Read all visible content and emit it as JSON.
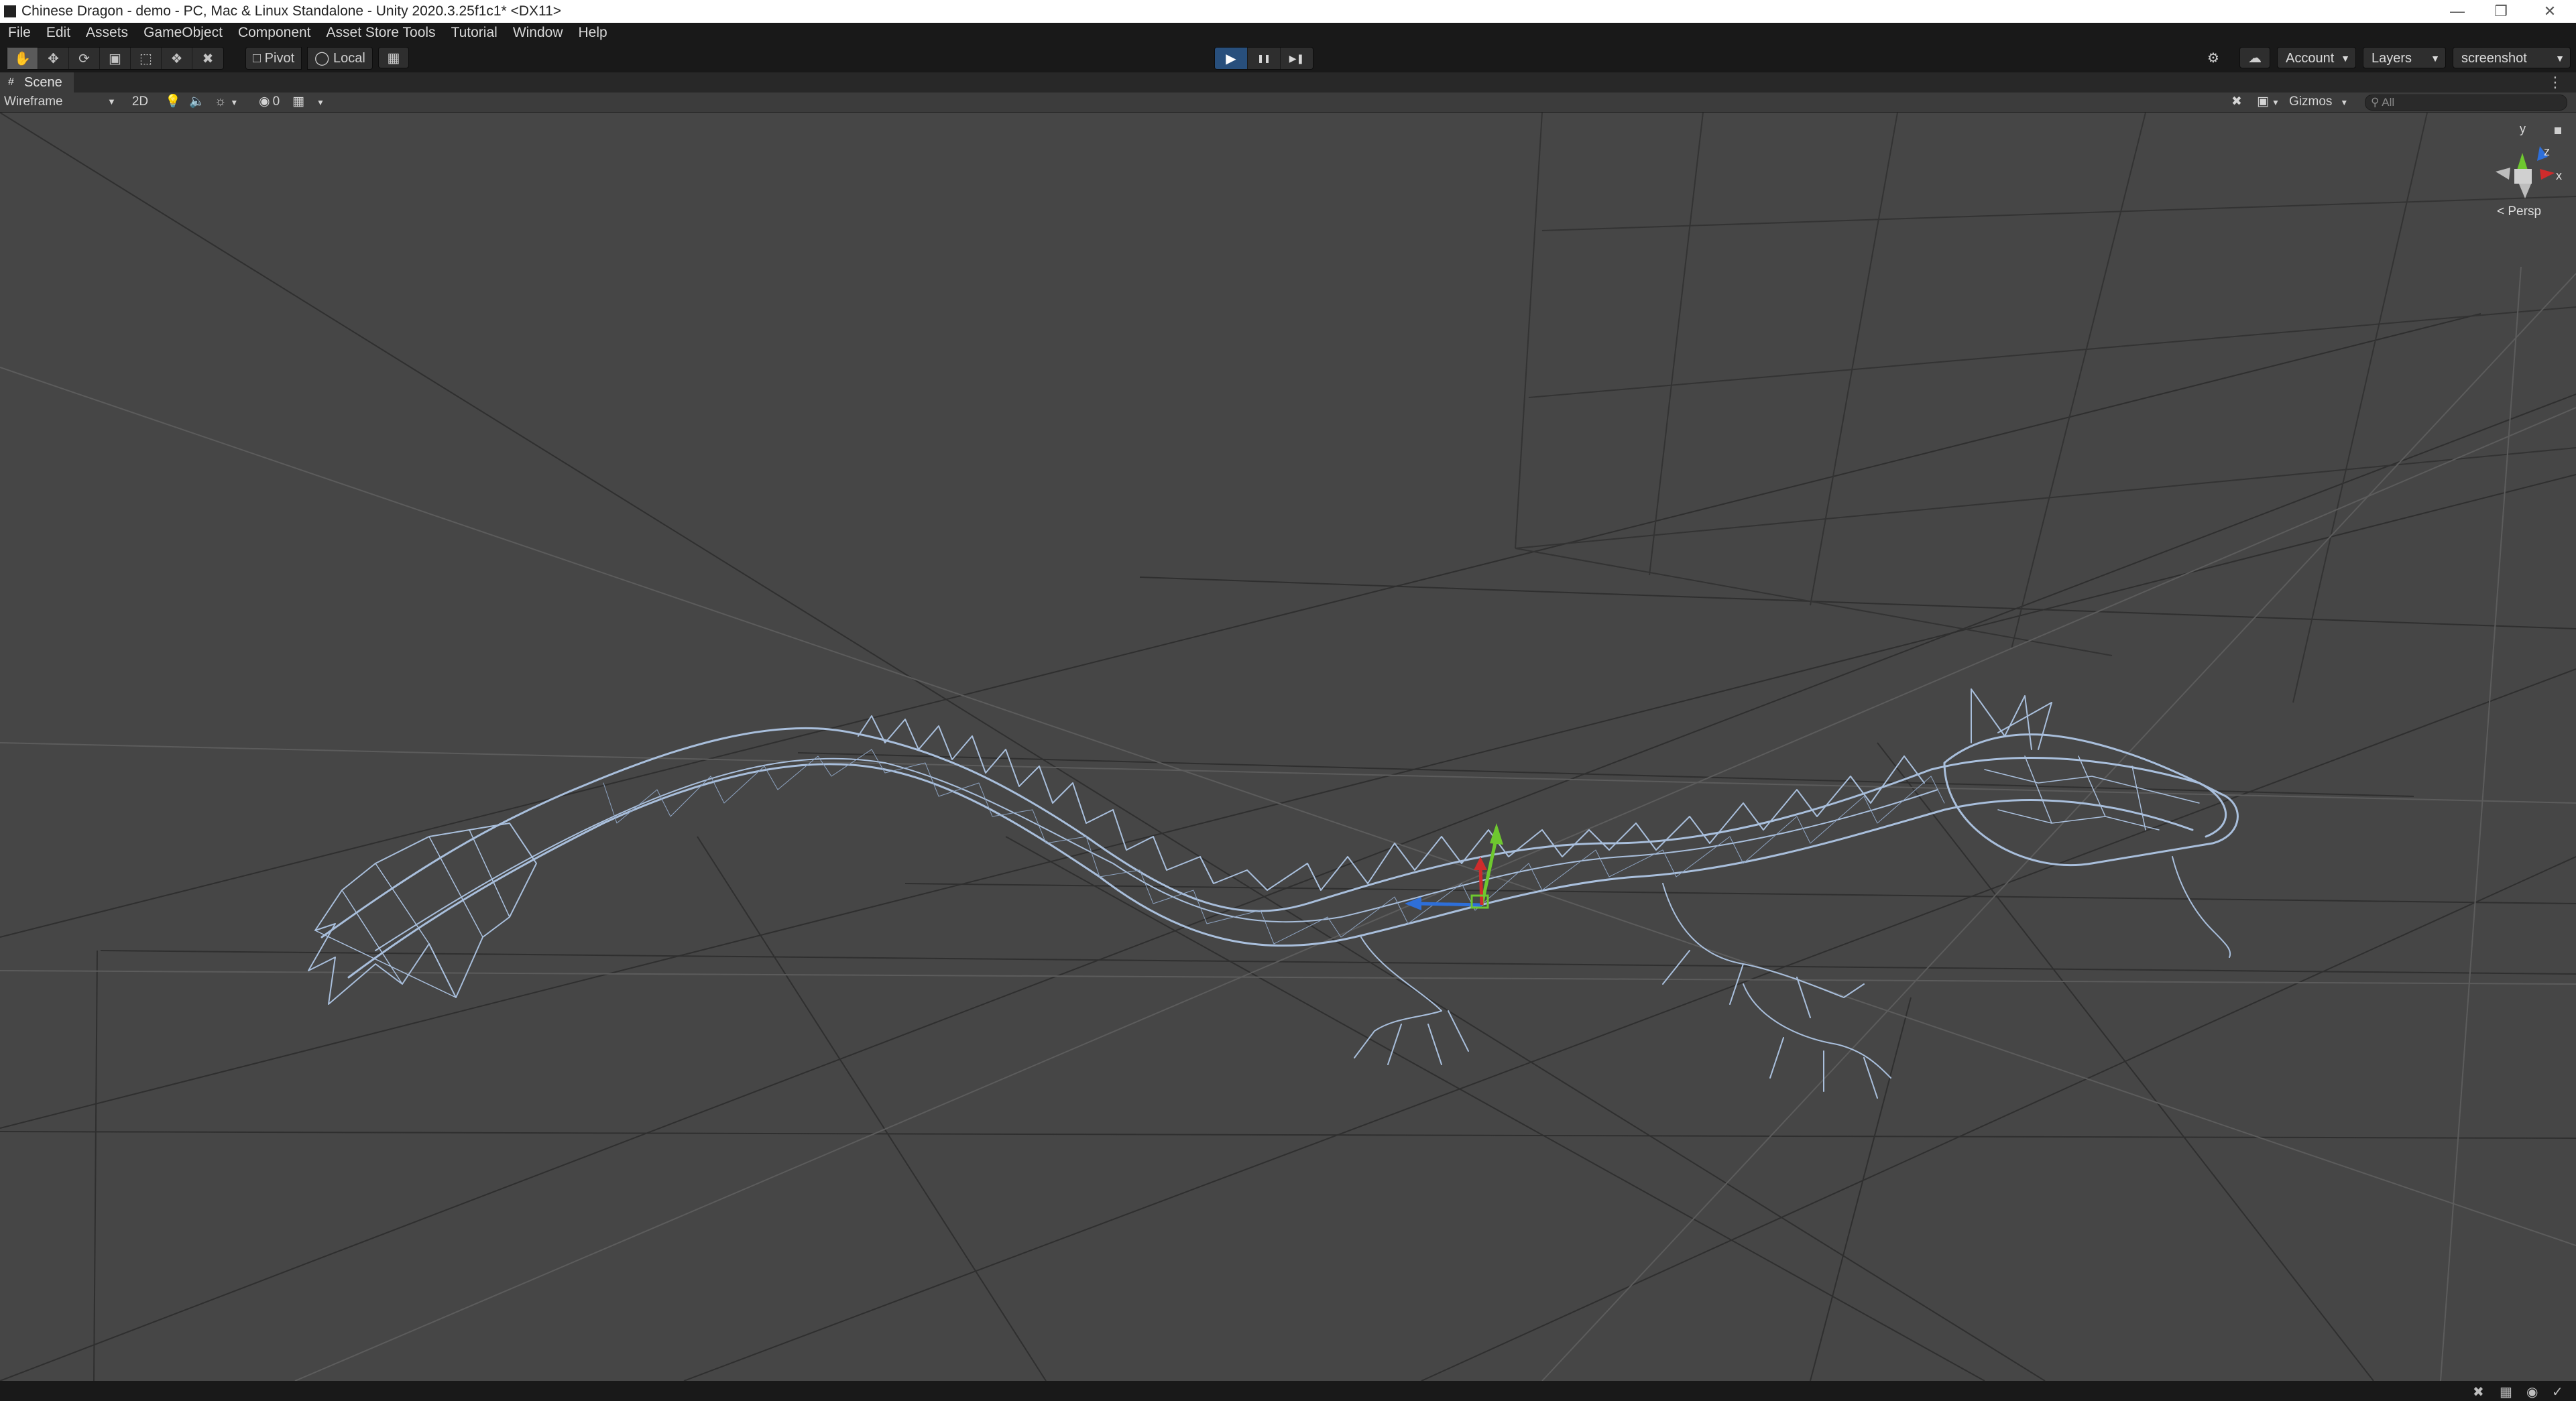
{
  "window": {
    "title": "Chinese Dragon - demo - PC, Mac & Linux Standalone - Unity 2020.3.25f1c1* <DX11>",
    "minimize": "—",
    "maximize": "❐",
    "close": "✕"
  },
  "menu": [
    "File",
    "Edit",
    "Assets",
    "GameObject",
    "Component",
    "Asset Store Tools",
    "Tutorial",
    "Window",
    "Help"
  ],
  "toolbar": {
    "pivot_label": "Pivot",
    "local_label": "Local",
    "account_label": "Account",
    "layers_label": "Layers",
    "layout_label": "screenshot",
    "play_icon": "▶",
    "pause_icon": "❚❚",
    "step_icon": "▶❚"
  },
  "scene": {
    "tab_label": "Scene",
    "tab_icon": "#",
    "draw_mode": "Wireframe",
    "mode_2d": "2D",
    "hidden_count": "0",
    "gizmos_label": "Gizmos",
    "search_placeholder": "All",
    "persp_label": "< Persp",
    "gizmo_axes": {
      "y": "y",
      "z": "z",
      "x": "x"
    }
  }
}
